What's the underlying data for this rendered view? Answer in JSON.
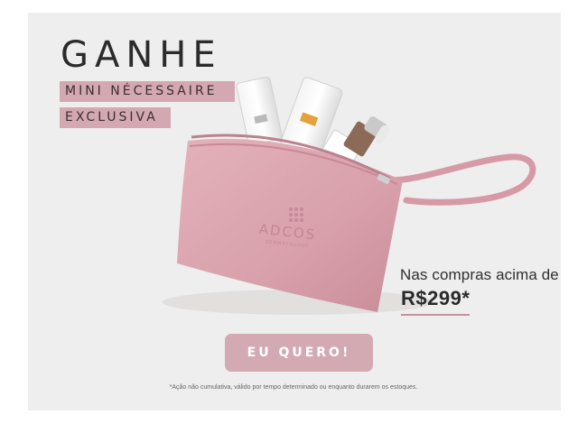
{
  "headline": "GANHE",
  "tags": [
    "MINI NÉCESSAIRE",
    "EXCLUSIVA"
  ],
  "product": {
    "brand_mark": "ADCOS",
    "brand_sub": "DERMATOLOGY"
  },
  "offer": {
    "text": "Nas compras acima de",
    "price": "R$299*"
  },
  "cta_label": "EU QUERO!",
  "disclaimer": "*Ação não cumulativa, válido por tempo determinado ou enquanto durarem os estoques.",
  "colors": {
    "pink": "#d4a8b2",
    "pouch": "#d9a2ad",
    "background": "#efeeee"
  }
}
